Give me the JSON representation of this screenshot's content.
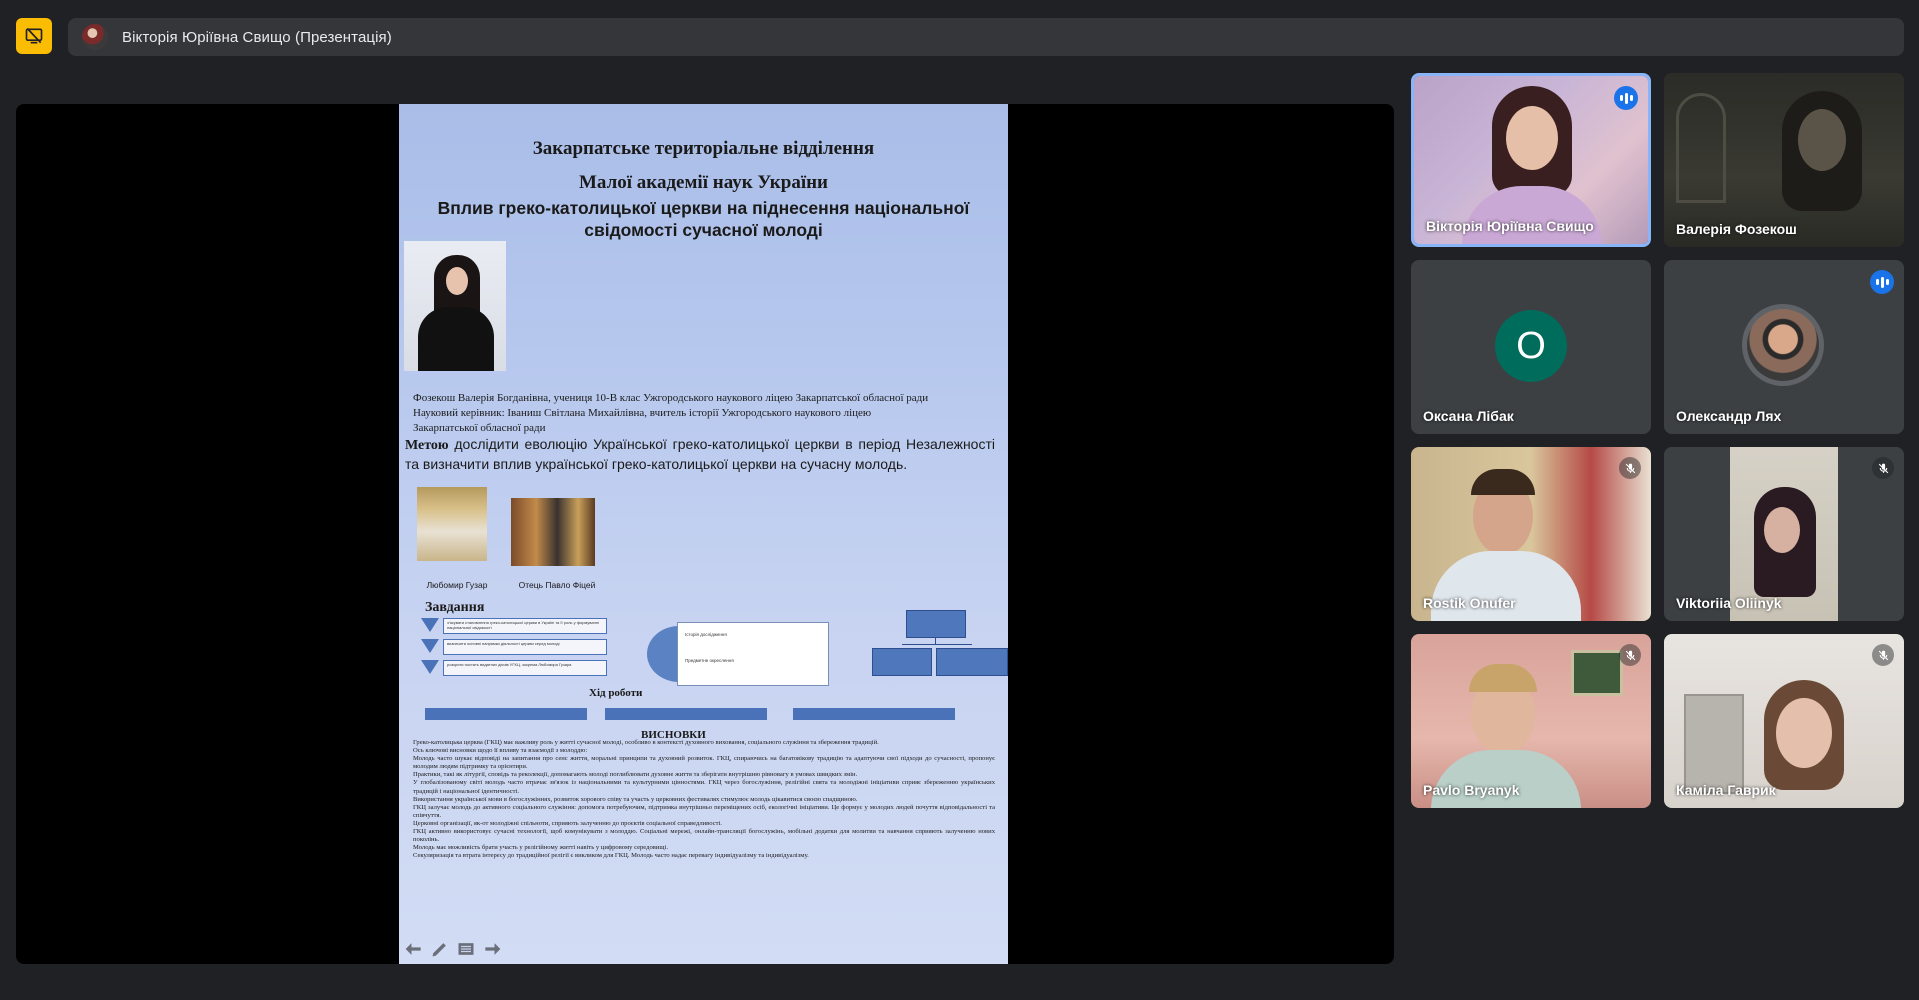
{
  "app": {
    "presenter_title": "Вікторія Юріївна Свищо (Презентація)",
    "icons": {
      "present": "stop-presenting-icon",
      "avatar": "presenter-avatar"
    },
    "colors": {
      "background": "#202124",
      "present_button": "#fbbc04",
      "active_speaker_border": "#8ab4f8",
      "talk_indicator": "#1a73e8"
    }
  },
  "slide": {
    "heading1": "Закарпатське територіальне відділення",
    "heading2": "Малої академії наук України",
    "heading3": "Вплив греко-католицької церкви на піднесення національної свідомості сучасної молоді",
    "authors_line1": "Фозекош Валерія Богданівна, учениця 10-В клас Ужгородського наукового ліцею  Закарпатської обласної ради",
    "authors_line2": "Науковий керівник:  Іваниш Світлана Михайлівна, вчитель історії Ужгородського наукового ліцею",
    "authors_line3": "Закарпатської обласної ради",
    "goal_label": "Метою",
    "goal_text": "  дослідити еволюцію Української греко-католицької церкви в період Незалежності та визначити вплив української греко-католицької церкви на сучасну молодь.",
    "caption1": "Любомир Гузар",
    "caption2": "Отець Павло Фіцей",
    "tasks_heading": "Завдання",
    "tasks": [
      "з'ясувати становлення греко-католицької церкви в Україні та її роль у формуванні національної свідомості",
      "визначити основні напрямки діяльності церкви серед молоді",
      "розкрити постать видатних діячів УГКЦ, зокрема Любомира Гузара"
    ],
    "diagram_labels": [
      "Історія дослідження",
      "Предметне окреслення"
    ],
    "work_heading": "Хід роботи",
    "conclusions_heading": "ВИСНОВКИ",
    "conclusions": [
      "Греко-католицька церква (ГКЦ) має важливу роль у житті сучасної молоді, особливо в контексті духовного виховання, соціального служіння та збереження традицій.",
      "Ось ключові висновки щодо її впливу та взаємодії з молоддю:",
      "Молодь часто шукає відповіді на запитання про сенс життя, моральні принципи та духовний розвиток. ГКЦ, спираючись на багатовікову традицію та адаптуючи свої підходи до сучасності, пропонує молодим людям підтримку та орієнтири.",
      "Практики, такі як літургії, сповідь та реколекції, допомагають молоді поглиблювати духовне життя та зберігати внутрішню рівновагу в умовах швидких змін.",
      "У глобалізованому світі молодь часто втрачає зв'язок із національними та культурними цінностями. ГКЦ через богослужіння, релігійні свята та молодіжні ініціативи сприяє збереженню українських традицій і національної ідентичності.",
      "Використання української мови в богослужіннях, розвиток хорового співу та участь у церковних фестивалях стимулює молодь цікавитися своєю спадщиною.",
      "ГКЦ залучає молодь до активного соціального служіння: допомога потребуючим, підтримка внутрішньо переміщених осіб, екологічні ініціативи. Це формує у молодих людей почуття відповідальності та співчуття.",
      "Церковні організації, як-от молодіжні спільноти, сприяють залученню до проєктів соціальної справедливості.",
      "ГКЦ активно використовує сучасні технології, щоб комунікувати з молоддю. Соціальні мережі, онлайн-трансляції богослужінь, мобільні додатки для молитви та навчання сприяють залученню нових поколінь.",
      "Молодь має можливість брати участь у релігійному житті навіть у цифровому середовищі.",
      "Секуляризація та втрата інтересу до традиційної релігії є викликом для ГКЦ. Молодь часто надає перевагу індивідуалізму та індивідуалізму."
    ],
    "controls": [
      "previous-slide-icon",
      "pen-icon",
      "notes-icon",
      "next-slide-icon"
    ]
  },
  "participants": [
    {
      "name": "Вікторія Юріївна Свищо",
      "talking": true,
      "active": true
    },
    {
      "name": "Валерія Фозекош",
      "talking": false,
      "muted": false
    },
    {
      "name": "Оксана Лібак",
      "initial": "О",
      "talking": false
    },
    {
      "name": "Олександр Лях",
      "talking": true
    },
    {
      "name": "Rostik Onufer",
      "muted": true
    },
    {
      "name": "Viktoriia Oliinyk",
      "muted": true
    },
    {
      "name": "Pavlo Bryanyk",
      "muted": true
    },
    {
      "name": "Каміла Гаврик",
      "muted": true
    }
  ]
}
